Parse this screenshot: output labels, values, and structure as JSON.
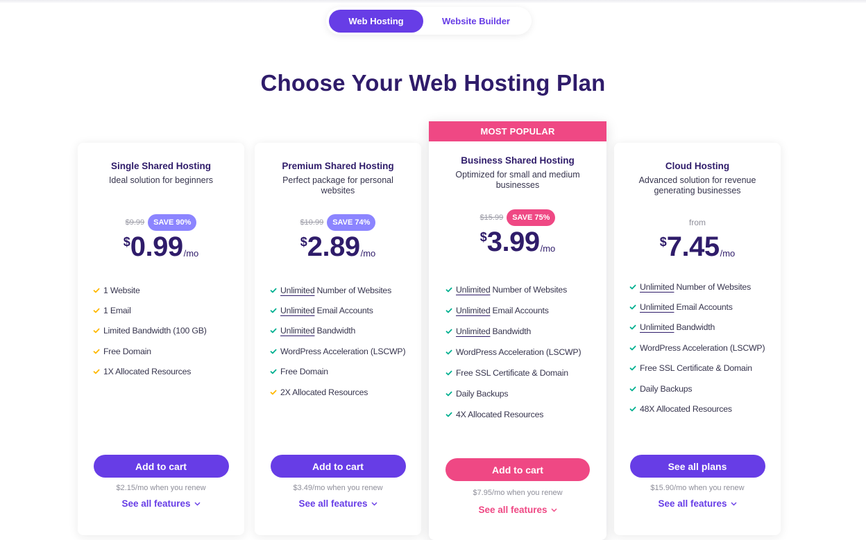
{
  "tabs": [
    {
      "label": "Web Hosting",
      "active": true
    },
    {
      "label": "Website Builder",
      "active": false
    }
  ],
  "title": "Choose Your Web Hosting Plan",
  "colors": {
    "primary": "#673de6",
    "accent": "#ef4884",
    "heading": "#2f1c6a",
    "check_green": "#00b090",
    "check_yellow": "#ffb800"
  },
  "plans": [
    {
      "name": "Single Shared Hosting",
      "description": "Ideal solution for beginners",
      "old_price": "$9.99",
      "save": "SAVE 90%",
      "currency": "$",
      "price": "0.99",
      "period": "/mo",
      "features": [
        {
          "underline": "",
          "text": "1 Website",
          "check": "yellow"
        },
        {
          "underline": "",
          "text": "1 Email",
          "check": "yellow"
        },
        {
          "underline": "",
          "text": "Limited Bandwidth (100 GB)",
          "check": "yellow"
        },
        {
          "underline": "",
          "text": "Free Domain",
          "check": "yellow"
        },
        {
          "underline": "",
          "text": "1X Allocated Resources",
          "check": "yellow"
        }
      ],
      "cta": "Add to cart",
      "renew": "$2.15/mo when you renew",
      "see_all": "See all features"
    },
    {
      "name": "Premium Shared Hosting",
      "description": "Perfect package for personal websites",
      "old_price": "$10.99",
      "save": "SAVE 74%",
      "currency": "$",
      "price": "2.89",
      "period": "/mo",
      "features": [
        {
          "underline": "Unlimited",
          "text": "Number of Websites",
          "check": "green"
        },
        {
          "underline": "Unlimited",
          "text": "Email Accounts",
          "check": "green"
        },
        {
          "underline": "Unlimited",
          "text": "Bandwidth",
          "check": "green"
        },
        {
          "underline": "",
          "text": "WordPress Acceleration (LSCWP)",
          "check": "green"
        },
        {
          "underline": "",
          "text": "Free Domain",
          "check": "green"
        },
        {
          "underline": "",
          "text": "2X Allocated Resources",
          "check": "yellow"
        }
      ],
      "cta": "Add to cart",
      "renew": "$3.49/mo when you renew",
      "see_all": "See all features"
    },
    {
      "badge": "MOST POPULAR",
      "name": "Business Shared Hosting",
      "description": "Optimized for small and medium businesses",
      "old_price": "$15.99",
      "save": "SAVE 75%",
      "currency": "$",
      "price": "3.99",
      "period": "/mo",
      "features": [
        {
          "underline": "Unlimited",
          "text": "Number of Websites",
          "check": "green"
        },
        {
          "underline": "Unlimited",
          "text": "Email Accounts",
          "check": "green"
        },
        {
          "underline": "Unlimited",
          "text": "Bandwidth",
          "check": "green"
        },
        {
          "underline": "",
          "text": "WordPress Acceleration (LSCWP)",
          "check": "green"
        },
        {
          "underline": "",
          "text": "Free SSL Certificate & Domain",
          "check": "green"
        },
        {
          "underline": "",
          "text": "Daily Backups",
          "check": "green"
        },
        {
          "underline": "",
          "text": "4X Allocated Resources",
          "check": "green"
        }
      ],
      "cta": "Add to cart",
      "renew": "$7.95/mo when you renew",
      "see_all": "See all features"
    },
    {
      "name": "Cloud Hosting",
      "description": "Advanced solution for revenue generating businesses",
      "from": "from",
      "currency": "$",
      "price": "7.45",
      "period": "/mo",
      "features": [
        {
          "underline": "Unlimited",
          "text": "Number of Websites",
          "check": "green"
        },
        {
          "underline": "Unlimited",
          "text": "Email Accounts",
          "check": "green"
        },
        {
          "underline": "Unlimited",
          "text": "Bandwidth",
          "check": "green"
        },
        {
          "underline": "",
          "text": "WordPress Acceleration (LSCWP)",
          "check": "green"
        },
        {
          "underline": "",
          "text": "Free SSL Certificate & Domain",
          "check": "green"
        },
        {
          "underline": "",
          "text": "Daily Backups",
          "check": "green"
        },
        {
          "underline": "",
          "text": "48X Allocated Resources",
          "check": "green"
        }
      ],
      "cta": "See all plans",
      "renew": "$15.90/mo when you renew",
      "see_all": "See all features"
    }
  ]
}
